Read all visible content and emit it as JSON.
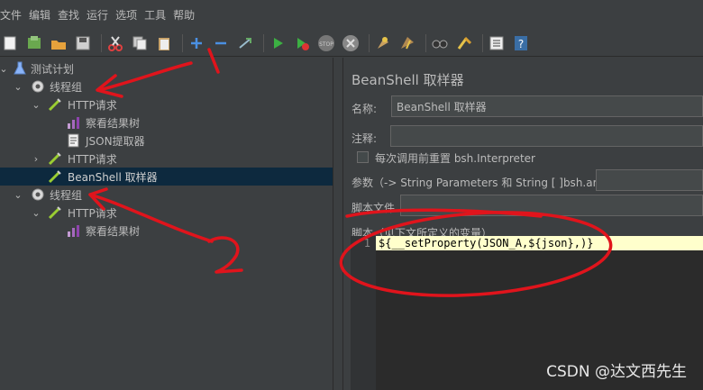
{
  "menu": [
    "文件",
    "编辑",
    "查找",
    "运行",
    "选项",
    "工具",
    "帮助"
  ],
  "toolbar": {
    "icons": [
      "new-icon",
      "templates-icon",
      "open-icon",
      "save-icon",
      "cut-icon",
      "copy-icon",
      "paste-icon",
      "expand-icon",
      "collapse-icon",
      "toggle-icon",
      "start-icon",
      "start-no-pause-icon",
      "stop-icon",
      "shutdown-icon",
      "clear-icon",
      "clear-all-icon",
      "search-icon",
      "reset-search-icon",
      "function-helper-icon",
      "help-icon"
    ]
  },
  "tree": {
    "test_plan": "测试计划",
    "thread_group_1": "线程组",
    "http_request_1": "HTTP请求",
    "view_results_tree_1": "察看结果树",
    "json_extractor": "JSON提取器",
    "http_request_2": "HTTP请求",
    "beanshell_sampler": "BeanShell 取样器",
    "thread_group_2": "线程组",
    "http_request_3": "HTTP请求",
    "view_results_tree_2": "察看结果树"
  },
  "form": {
    "title": "BeanShell 取样器",
    "name_label": "名称:",
    "name_value": "BeanShell 取样器",
    "comments_label": "注释:",
    "comments_value": "",
    "reset_interpreter_label": "每次调用前重置 bsh.Interpreter",
    "parameters_label": "参数（-> String Parameters 和 String [ ]bsh.args）",
    "script_file_label": "脚本文件",
    "script_label": "脚本（见下文所定义的变量）",
    "line_number": "1",
    "script_code": "${__setProperty(JSON_A,${json},)}"
  },
  "watermark": "CSDN @达文西先生",
  "annotations": {
    "mark_1": "1",
    "mark_2": "2"
  },
  "colors": {
    "selection": "#0d293e",
    "background": "#3c3f41",
    "annotation": "#e0141c",
    "code_highlight": "#ffffcc"
  }
}
